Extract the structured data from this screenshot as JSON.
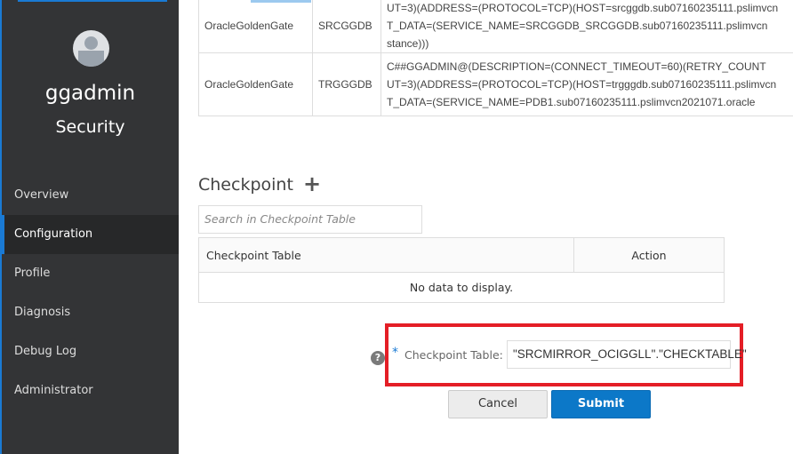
{
  "sidebar": {
    "username": "ggadmin",
    "role": "Security",
    "items": [
      {
        "label": "Overview"
      },
      {
        "label": "Configuration",
        "active": true
      },
      {
        "label": "Profile"
      },
      {
        "label": "Diagnosis"
      },
      {
        "label": "Debug Log"
      },
      {
        "label": "Administrator"
      }
    ]
  },
  "connections": {
    "rows": [
      {
        "domain": "OracleGoldenGate",
        "alias": "SRCGGDB",
        "lines": [
          "UT=3)(ADDRESS=(PROTOCOL=TCP)(HOST=srcggdb.sub07160235111.pslimvcn",
          "T_DATA=(SERVICE_NAME=SRCGGDB_SRCGGDB.sub07160235111.pslimvcn",
          "stance)))"
        ]
      },
      {
        "domain": "OracleGoldenGate",
        "alias": "TRGGGDB",
        "lines": [
          "C##GGADMIN@(DESCRIPTION=(CONNECT_TIMEOUT=60)(RETRY_COUNT",
          "UT=3)(ADDRESS=(PROTOCOL=TCP)(HOST=trgggdb.sub07160235111.pslimvcn",
          "T_DATA=(SERVICE_NAME=PDB1.sub07160235111.pslimvcn2021071.oracle"
        ]
      }
    ]
  },
  "checkpoint": {
    "title": "Checkpoint",
    "search_placeholder": "Search in Checkpoint Table",
    "columns": [
      "Checkpoint Table",
      "Action"
    ],
    "empty": "No data to display.",
    "form": {
      "required": "*",
      "label": "Checkpoint Table:",
      "value": "\"SRCMIRROR_OCIGGLL\".\"CHECKTABLE\"",
      "cancel": "Cancel",
      "submit": "Submit"
    }
  },
  "colors": {
    "accent": "#0c78c8",
    "highlight": "#e41e26",
    "sidebar": "#333436"
  }
}
